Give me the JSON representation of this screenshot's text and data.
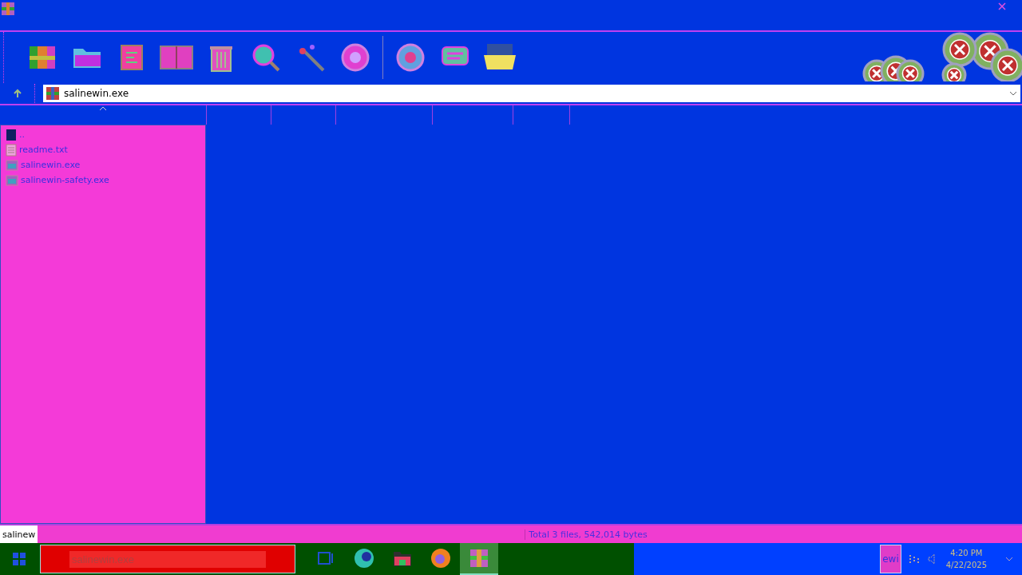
{
  "address": {
    "value": "salinewin.exe"
  },
  "files": [
    {
      "name": "..",
      "kind": "up"
    },
    {
      "name": "readme.txt",
      "kind": "text"
    },
    {
      "name": "salinewin.exe",
      "kind": "exe"
    },
    {
      "name": "salinewin-safety.exe",
      "kind": "exe"
    }
  ],
  "status_bar": {
    "left": "salinew",
    "text": "Total 3 files, 542,014 bytes"
  },
  "taskbar": {
    "search": {
      "placeholder": "salinewin.exe"
    },
    "apps": [
      {
        "kind": "taskview",
        "selected": false
      },
      {
        "kind": "edge",
        "selected": false
      },
      {
        "kind": "folder",
        "selected": false
      },
      {
        "kind": "firefox",
        "selected": false
      },
      {
        "kind": "archive",
        "selected": true
      }
    ],
    "tray_label": "ewi",
    "time": "4:20 PM",
    "date": "4/22/2025"
  }
}
